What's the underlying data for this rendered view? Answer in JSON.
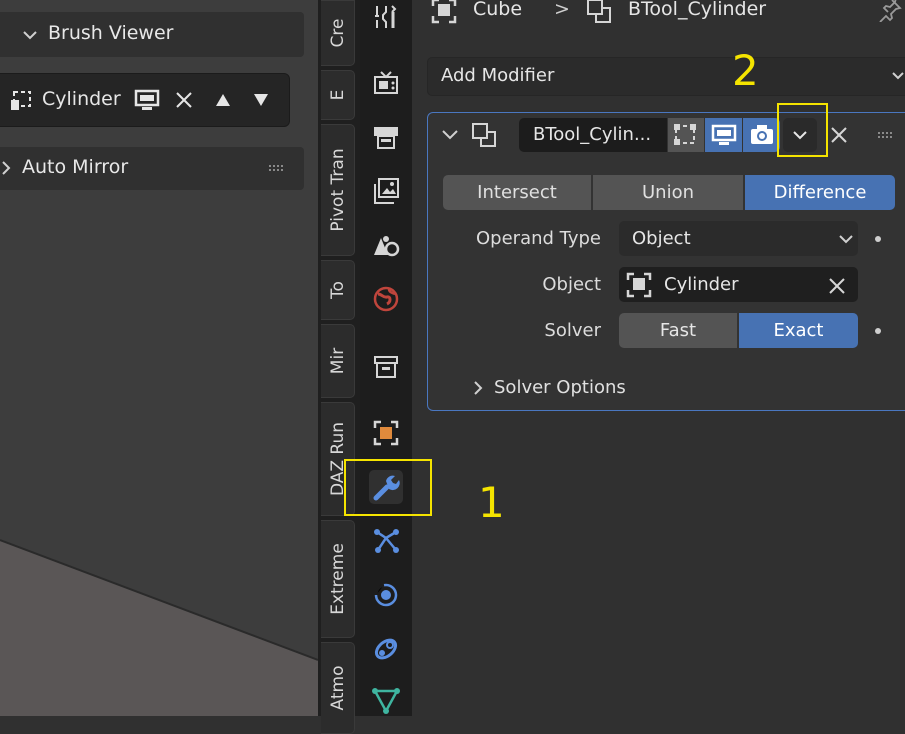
{
  "viewport": {
    "brush_viewer": {
      "label": "Brush Viewer",
      "chevron_icon": "chevron-down-icon"
    },
    "brush_item": {
      "label": "Cylinder",
      "icons": [
        "object-cursor-icon",
        "monitor-icon",
        "close-icon",
        "triangle-up-icon",
        "triangle-down-icon"
      ]
    },
    "auto_mirror": {
      "label": "Auto Mirror",
      "chevron_icon": "chevron-right-icon"
    }
  },
  "tabs": {
    "cre": "Cre",
    "e": "E",
    "pivot": "Pivot Tran",
    "to": "To",
    "mir": "Mir",
    "daz": "DAZ Run",
    "extreme": "Extreme",
    "atmo": "Atmo"
  },
  "property_icons": [
    "tool-icon",
    "render-icon",
    "output-icon",
    "view-layer-icon",
    "scene-icon",
    "world-icon",
    "collection-icon",
    "object-icon",
    "modifier-wrench-icon",
    "particles-icon",
    "physics-icon",
    "constraints-icon",
    "object-data-icon"
  ],
  "breadcrumb": {
    "object": "Cube",
    "separator": ">",
    "modifier": "BTool_Cylinder"
  },
  "add_modifier": {
    "label": "Add Modifier"
  },
  "modifier": {
    "name": "BTool_Cylin...",
    "operations": [
      "Intersect",
      "Union",
      "Difference"
    ],
    "active_operation": "Difference",
    "operand_type_label": "Operand Type",
    "operand_type_value": "Object",
    "object_label": "Object",
    "object_value": "Cylinder",
    "solver_label": "Solver",
    "solver_options": [
      "Fast",
      "Exact"
    ],
    "active_solver": "Exact",
    "solver_options_label": "Solver Options"
  },
  "annotations": {
    "one": "1",
    "two": "2"
  },
  "colors": {
    "accent": "#4772b3",
    "highlight": "#f5e400",
    "panel_border": "#4a77c0"
  }
}
